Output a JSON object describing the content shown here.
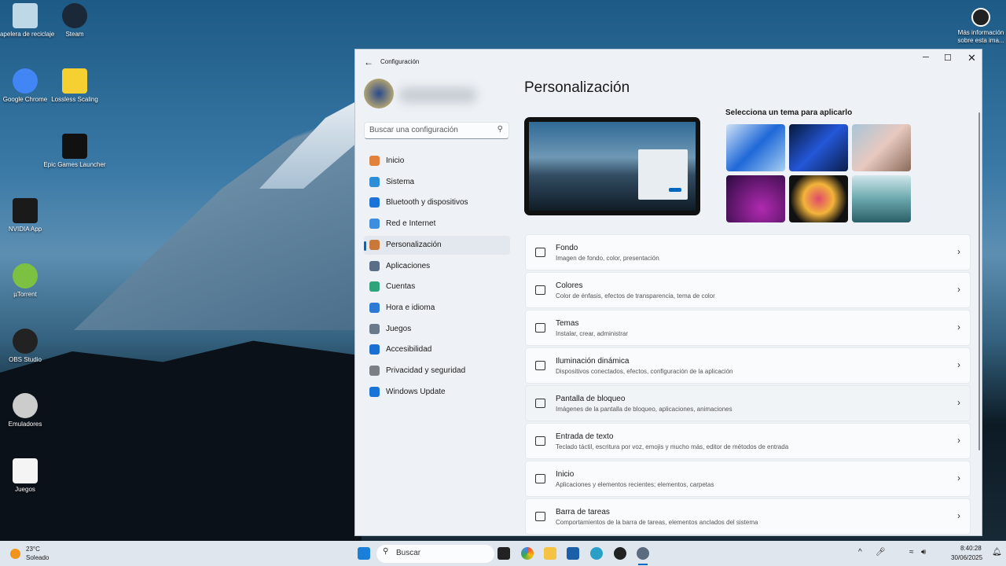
{
  "desktop": {
    "icons": [
      "Papelera de reciclaje",
      "Steam",
      "Google Chrome",
      "Lossless Scaling",
      "Epic Games Launcher",
      "NVIDIA App",
      "µTorrent",
      "OBS Studio",
      "Emuladores",
      "Juegos"
    ],
    "info": "Más información sobre esta ima..."
  },
  "window": {
    "title": "Configuración",
    "search_placeholder": "Buscar una configuración",
    "nav": [
      "Inicio",
      "Sistema",
      "Bluetooth y dispositivos",
      "Red e Internet",
      "Personalización",
      "Aplicaciones",
      "Cuentas",
      "Hora e idioma",
      "Juegos",
      "Accesibilidad",
      "Privacidad y seguridad",
      "Windows Update"
    ],
    "selected_nav": "Personalización",
    "page_title": "Personalización",
    "theme_label": "Selecciona un tema para aplicarlo",
    "cards": [
      {
        "title": "Fondo",
        "sub": "Imagen de fondo, color, presentación"
      },
      {
        "title": "Colores",
        "sub": "Color de énfasis, efectos de transparencia, tema de color"
      },
      {
        "title": "Temas",
        "sub": "Instalar, crear, administrar"
      },
      {
        "title": "Iluminación dinámica",
        "sub": "Dispositivos conectados, efectos, configuración de la aplicación"
      },
      {
        "title": "Pantalla de bloqueo",
        "sub": "Imágenes de la pantalla de bloqueo, aplicaciones, animaciones"
      },
      {
        "title": "Entrada de texto",
        "sub": "Teclado táctil, escritura por voz, emojis y mucho más, editor de métodos de entrada"
      },
      {
        "title": "Inicio",
        "sub": "Aplicaciones y elementos recientes; elementos, carpetas"
      },
      {
        "title": "Barra de tareas",
        "sub": "Comportamientos de la barra de tareas, elementos anclados del sistema"
      }
    ]
  },
  "taskbar": {
    "weather_temp": "23°C",
    "weather_text": "Soleado",
    "search": "Buscar",
    "time": "8:40:28",
    "date": "30/06/2025"
  },
  "colors": {
    "accent": "#0067c0"
  }
}
